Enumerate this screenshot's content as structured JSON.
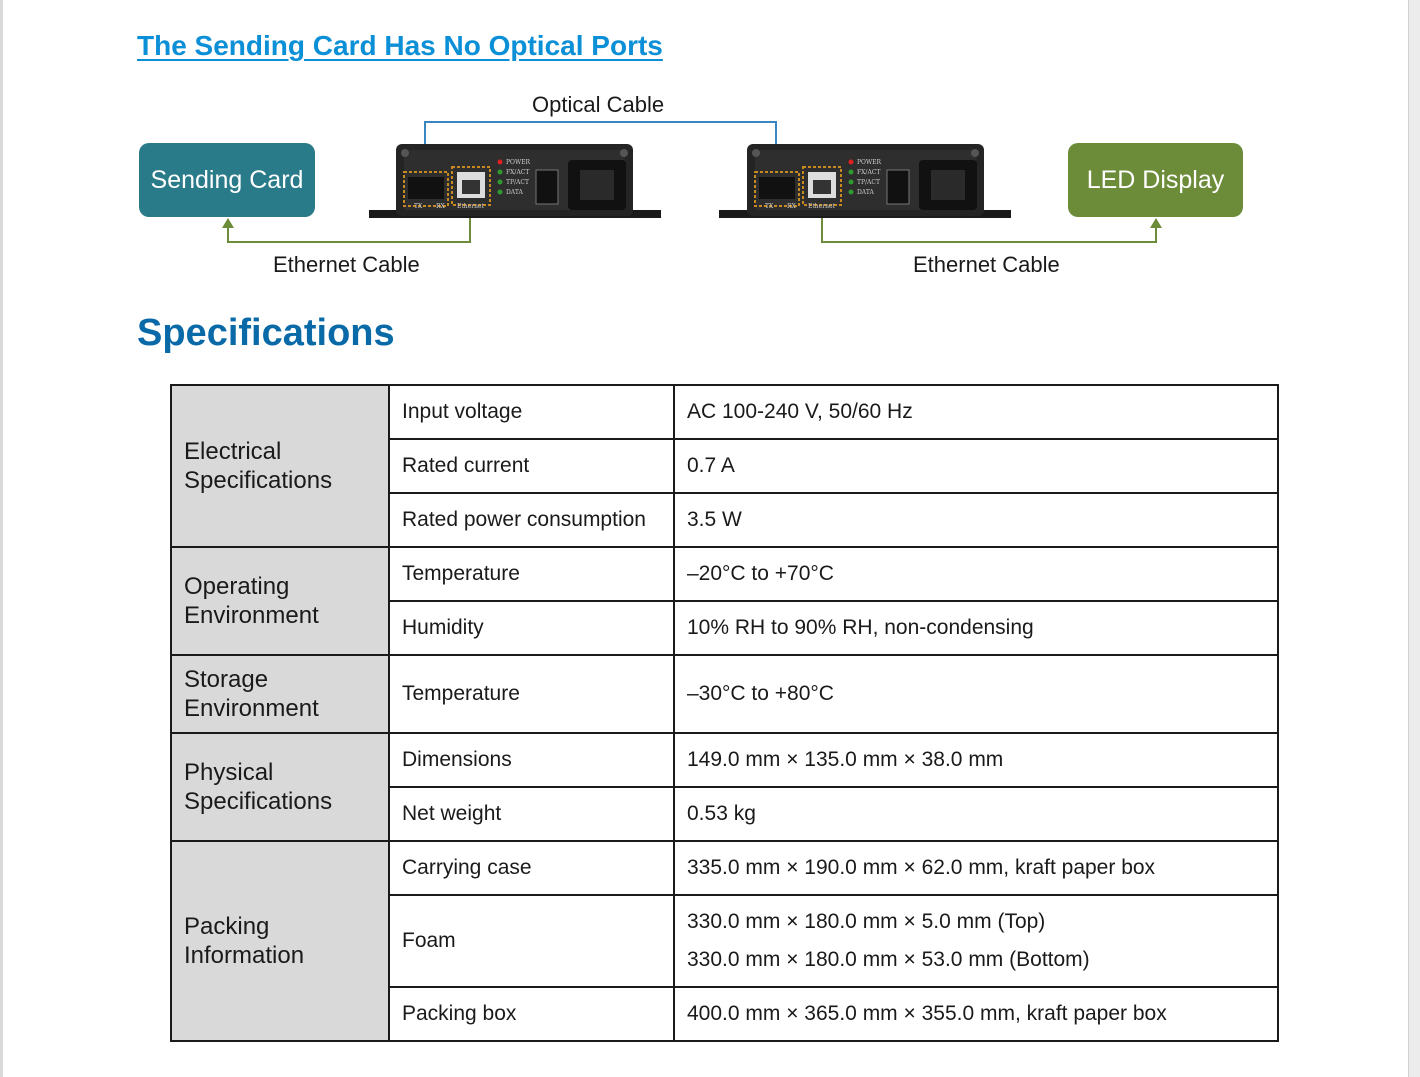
{
  "title": "The Sending Card Has No Optical Ports",
  "diagram": {
    "sending_card_label": "Sending Card",
    "led_display_label": "LED Display",
    "optical_cable_label": "Optical Cable",
    "ethernet_cable_left_label": "Ethernet Cable",
    "ethernet_cable_right_label": "Ethernet Cable",
    "device_port_labels": [
      "TX",
      "RX",
      "Ethernet"
    ],
    "device_led_labels": [
      "POWER",
      "FX/ACT",
      "TP/ACT",
      "DATA"
    ],
    "colors": {
      "sending_card": "#2a7b8a",
      "led_display": "#6c8c3a",
      "optical_cable_line": "#3a86c0",
      "ethernet_cable_line": "#6c8c3a"
    }
  },
  "specifications_heading": "Specifications",
  "groups": [
    {
      "category": [
        "Electrical",
        "Specifications"
      ],
      "rows": [
        {
          "param": "Input voltage",
          "value": [
            "AC 100-240 V, 50/60 Hz"
          ]
        },
        {
          "param": "Rated current",
          "value": [
            "0.7 A"
          ]
        },
        {
          "param": "Rated power consumption",
          "value": [
            "3.5 W"
          ]
        }
      ]
    },
    {
      "category": [
        "Operating",
        "Environment"
      ],
      "rows": [
        {
          "param": "Temperature",
          "value": [
            "–20°C to +70°C"
          ]
        },
        {
          "param": "Humidity",
          "value": [
            "10% RH to 90% RH, non-condensing"
          ]
        }
      ]
    },
    {
      "category": [
        "Storage",
        "Environment"
      ],
      "rows": [
        {
          "param": "Temperature",
          "value": [
            "–30°C to +80°C"
          ]
        }
      ]
    },
    {
      "category": [
        "Physical",
        "Specifications"
      ],
      "rows": [
        {
          "param": "Dimensions",
          "value": [
            "149.0 mm × 135.0 mm × 38.0 mm"
          ]
        },
        {
          "param": "Net weight",
          "value": [
            "0.53 kg"
          ]
        }
      ]
    },
    {
      "category": [
        "Packing",
        "Information"
      ],
      "rows": [
        {
          "param": "Carrying case",
          "value": [
            "335.0 mm × 190.0 mm × 62.0 mm, kraft paper box"
          ]
        },
        {
          "param": "Foam",
          "value": [
            "330.0 mm × 180.0 mm × 5.0 mm (Top)",
            "330.0 mm × 180.0 mm × 53.0 mm (Bottom)"
          ]
        },
        {
          "param": "Packing box",
          "value": [
            "400.0 mm × 365.0 mm × 355.0 mm, kraft paper box"
          ]
        }
      ]
    }
  ]
}
